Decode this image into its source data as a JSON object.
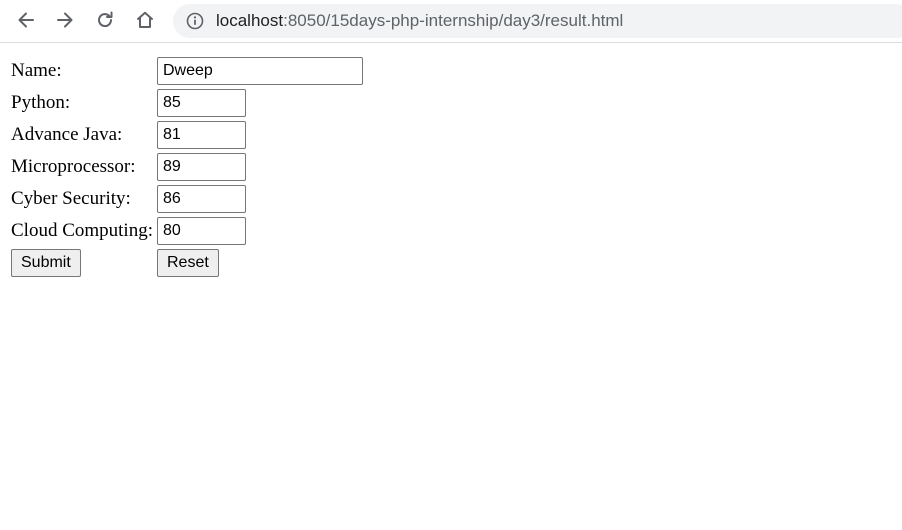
{
  "browser": {
    "url_host": "localhost",
    "url_path": ":8050/15days-php-internship/day3/result.html"
  },
  "form": {
    "fields": [
      {
        "label": "Name:",
        "value": "Dweep"
      },
      {
        "label": "Python:",
        "value": "85"
      },
      {
        "label": "Advance Java:",
        "value": "81"
      },
      {
        "label": "Microprocessor:",
        "value": "89"
      },
      {
        "label": "Cyber Security:",
        "value": "86"
      },
      {
        "label": "Cloud Computing:",
        "value": "80"
      }
    ],
    "submit_label": "Submit",
    "reset_label": "Reset"
  },
  "icons": {
    "back": "arrow-left-icon",
    "forward": "arrow-right-icon",
    "reload": "reload-icon",
    "home": "home-icon",
    "site_info": "info-circle-icon"
  }
}
